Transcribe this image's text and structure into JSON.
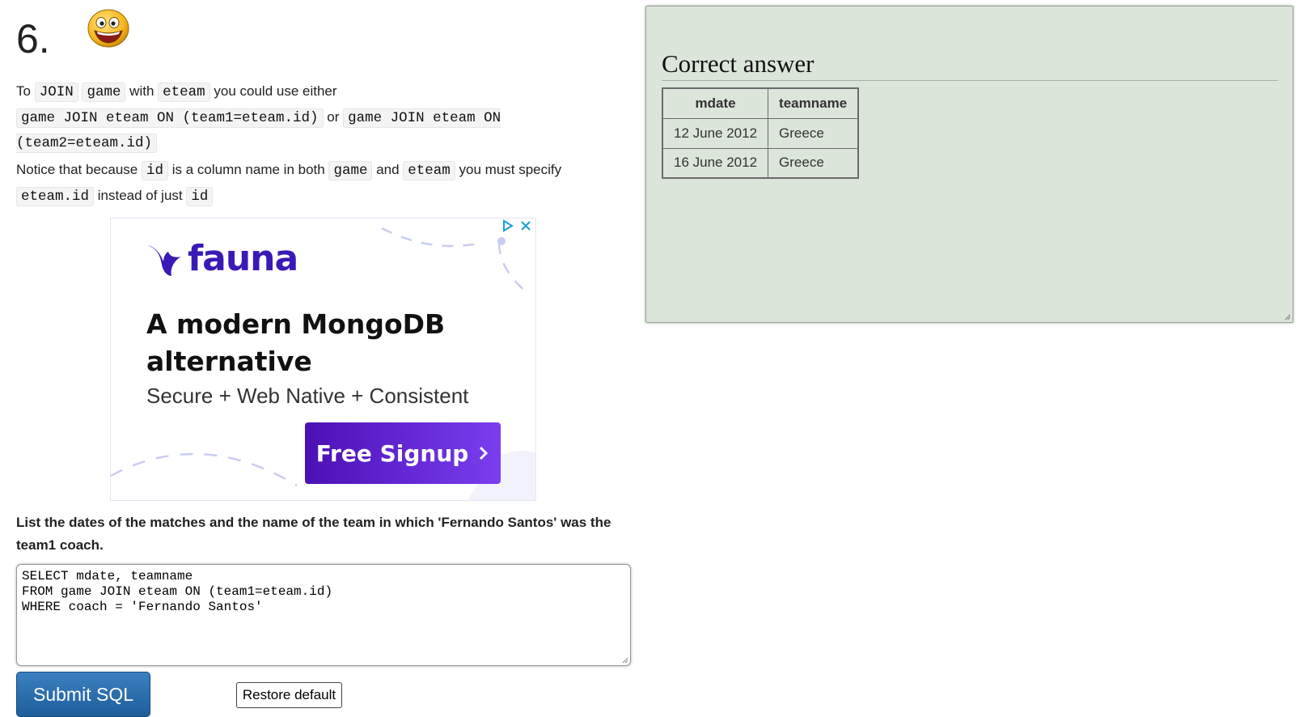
{
  "question": {
    "number": "6."
  },
  "intro": {
    "p1": {
      "t1": "To ",
      "c1": "JOIN",
      "c2": "game",
      "t2": " with ",
      "c3": "eteam",
      "t3": " you could use either",
      "c4": "game JOIN eteam ON (team1=eteam.id)",
      "t4": " or ",
      "c5": "game JOIN eteam ON (team2=eteam.id)"
    },
    "p2": {
      "t1": "Notice that because ",
      "c1": "id",
      "t2": " is a column name in both ",
      "c2": "game",
      "t3": " and ",
      "c3": "eteam",
      "t4": " you must specify ",
      "c4": "eteam.id",
      "t5": " instead of just ",
      "c5": "id"
    }
  },
  "ad": {
    "brand": "fauna",
    "headline": "A modern MongoDB alternative",
    "subline": "Secure + Web Native + Consistent",
    "cta": "Free Signup",
    "colors": {
      "brand": "#3a1ab6",
      "cta_start": "#4b10b4",
      "cta_end": "#7a3ef0",
      "deco": "#c9cdf0"
    }
  },
  "prompt": "List the dates of the matches and the name of the team in which 'Fernando Santos' was the team1 coach.",
  "sql": {
    "line1": "SELECT mdate, teamname",
    "line2": "FROM game JOIN eteam ON (team1=eteam.id)",
    "line3": "WHERE coach = 'Fernando Santos'"
  },
  "buttons": {
    "submit": "Submit SQL",
    "restore": "Restore default"
  },
  "answer": {
    "title": "Correct answer",
    "columns": [
      "mdate",
      "teamname"
    ],
    "rows": [
      [
        "12 June 2012",
        "Greece"
      ],
      [
        "16 June 2012",
        "Greece"
      ]
    ],
    "colors": {
      "panel_bg": "#dbe5da"
    }
  }
}
